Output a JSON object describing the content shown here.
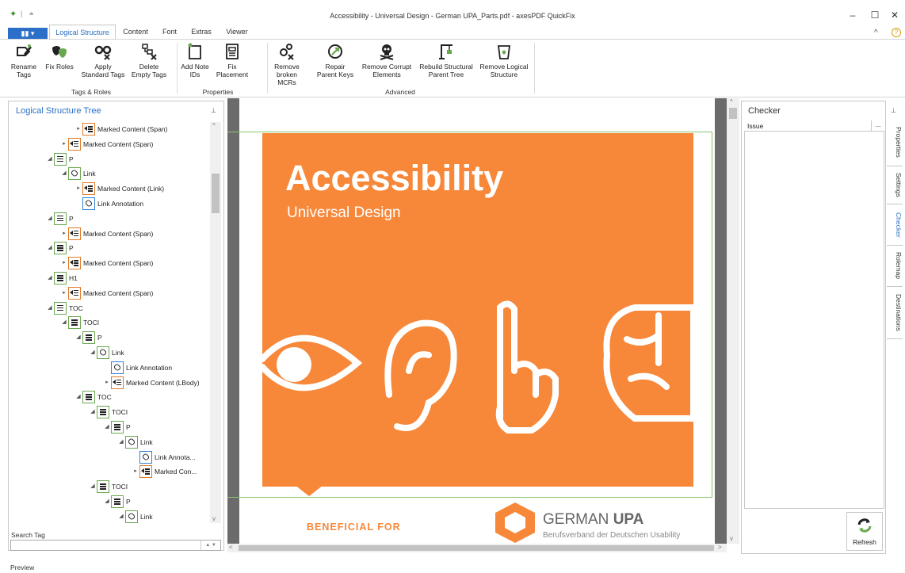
{
  "title": "Accessibility - Universal Design - German UPA_Parts.pdf - axesPDF QuickFix",
  "window_controls": {
    "minimize": "–",
    "maximize": "☐",
    "close": "✕"
  },
  "tabs": {
    "file": "▮▮ ▾",
    "items": [
      "Logical Structure",
      "Content",
      "Font",
      "Extras",
      "Viewer"
    ],
    "active": "Logical Structure"
  },
  "ribbon": {
    "groups": [
      {
        "label": "Tags & Roles"
      },
      {
        "label": "Properties"
      },
      {
        "label": "Advanced"
      }
    ],
    "buttons": {
      "rename_tags": "Rename Tags",
      "fix_roles": "Fix Roles",
      "apply_standard_tags": "Apply Standard Tags",
      "delete_empty_tags": "Delete Empty Tags",
      "add_note_ids": "Add Note IDs",
      "fix_placement": "Fix Placement",
      "remove_broken_mcrs": "Remove broken MCRs",
      "repair_parent_keys": "Repair Parent Keys",
      "remove_corrupt_elements": "Remove Corrupt Elements",
      "rebuild_structural_parent_tree": "Rebuild Structural Parent Tree",
      "remove_logical_structure": "Remove Logical Structure"
    }
  },
  "left_panel": {
    "title": "Logical Structure Tree",
    "pin": "⊥",
    "search_label": "Search Tag",
    "search_value": "",
    "tree": [
      {
        "label": "Marked Content (Span)",
        "icon": "marked-content",
        "color": "orange",
        "expander": "▸"
      },
      {
        "label": "Marked Content (Span)",
        "icon": "marked-content",
        "color": "orange",
        "expander": "▸"
      },
      {
        "label": "P",
        "icon": "paragraph",
        "color": "green",
        "expander": "◢"
      },
      {
        "label": "Link",
        "icon": "link",
        "color": "green",
        "expander": "◢"
      },
      {
        "label": "Marked Content (Link)",
        "icon": "marked-content",
        "color": "orange",
        "expander": "▸"
      },
      {
        "label": "Link Annotation",
        "icon": "link",
        "color": "blue",
        "expander": ""
      },
      {
        "label": "P",
        "icon": "paragraph",
        "color": "green",
        "expander": "◢"
      },
      {
        "label": "Marked Content (Span)",
        "icon": "marked-content",
        "color": "orange",
        "expander": "▸"
      },
      {
        "label": "P",
        "icon": "paragraph",
        "color": "green",
        "expander": "◢"
      },
      {
        "label": "Marked Content (Span)",
        "icon": "marked-content",
        "color": "orange",
        "expander": "▸"
      },
      {
        "label": "H1",
        "icon": "heading",
        "color": "green",
        "expander": "◢"
      },
      {
        "label": "Marked Content (Span)",
        "icon": "marked-content",
        "color": "orange",
        "expander": "▸"
      },
      {
        "label": "TOC",
        "icon": "toc",
        "color": "green",
        "expander": "◢"
      },
      {
        "label": "TOCI",
        "icon": "toc",
        "color": "green",
        "expander": "◢"
      },
      {
        "label": "P",
        "icon": "paragraph",
        "color": "green",
        "expander": "◢"
      },
      {
        "label": "Link",
        "icon": "link",
        "color": "green",
        "expander": "◢"
      },
      {
        "label": "Link Annotation",
        "icon": "link",
        "color": "blue",
        "expander": ""
      },
      {
        "label": "Marked Content (LBody)",
        "icon": "marked-content",
        "color": "orange",
        "expander": "▸"
      },
      {
        "label": "TOC",
        "icon": "toc",
        "color": "green",
        "expander": "◢"
      },
      {
        "label": "TOCI",
        "icon": "toc",
        "color": "green",
        "expander": "◢"
      },
      {
        "label": "P",
        "icon": "paragraph",
        "color": "green",
        "expander": "◢"
      },
      {
        "label": "Link",
        "icon": "link",
        "color": "green",
        "expander": "◢"
      },
      {
        "label": "Link Annota...",
        "icon": "link",
        "color": "blue",
        "expander": ""
      },
      {
        "label": "Marked Con...",
        "icon": "marked-content",
        "color": "orange",
        "expander": "▸"
      },
      {
        "label": "TOCI",
        "icon": "toc",
        "color": "green",
        "expander": "◢"
      },
      {
        "label": "P",
        "icon": "paragraph",
        "color": "green",
        "expander": "◢"
      },
      {
        "label": "Link",
        "icon": "link",
        "color": "green",
        "expander": "◢"
      }
    ]
  },
  "document": {
    "title": "Accessibility",
    "subtitle": "Universal Design",
    "beneficial": "BENEFICIAL FOR EVERYONE",
    "logo_name_light": "GERMAN ",
    "logo_name_bold": "UPA",
    "logo_sub": "Berufsverband der Deutschen Usability",
    "accent_color": "#f7883a"
  },
  "checker": {
    "title": "Checker",
    "pin": "⊥",
    "column_issue": "Issue",
    "column_more": "...",
    "refresh": "Refresh",
    "side_tabs": [
      "Properties",
      "Settings",
      "Checker",
      "Rolemap",
      "Destinations"
    ],
    "active_side_tab": "Checker"
  },
  "status_text": "Preview"
}
